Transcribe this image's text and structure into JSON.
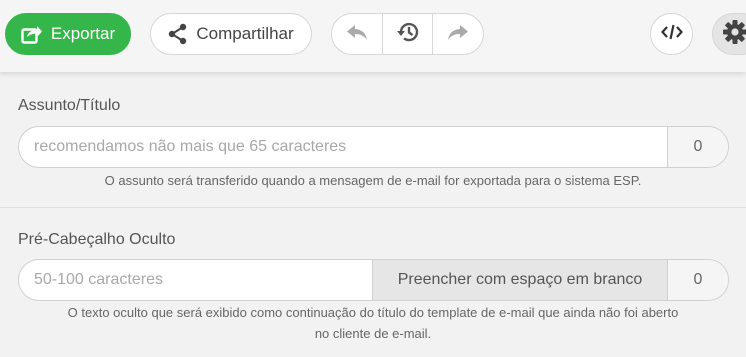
{
  "toolbar": {
    "export_label": "Exportar",
    "share_label": "Compartilhar",
    "icons": {
      "export": "export-icon",
      "share": "share-icon",
      "undo": "undo-icon",
      "history": "history-icon",
      "redo": "redo-icon",
      "code": "code-icon",
      "settings": "gear-icon"
    },
    "colors": {
      "export_bg": "#35b64a"
    }
  },
  "subject": {
    "label": "Assunto/Título",
    "placeholder": "recomendamos não mais que 65 caracteres",
    "count": "0",
    "help": "O assunto será transferido quando a mensagem de e-mail for exportada para o sistema ESP."
  },
  "preheader": {
    "label": "Pré-Cabeçalho Oculto",
    "placeholder": "50-100 caracteres",
    "fill_button": "Preencher com espaço em branco",
    "count": "0",
    "help_line1": "O texto oculto que será exibido como continuação do título do template de e-mail que ainda não foi aberto",
    "help_line2": "no cliente de e-mail."
  }
}
